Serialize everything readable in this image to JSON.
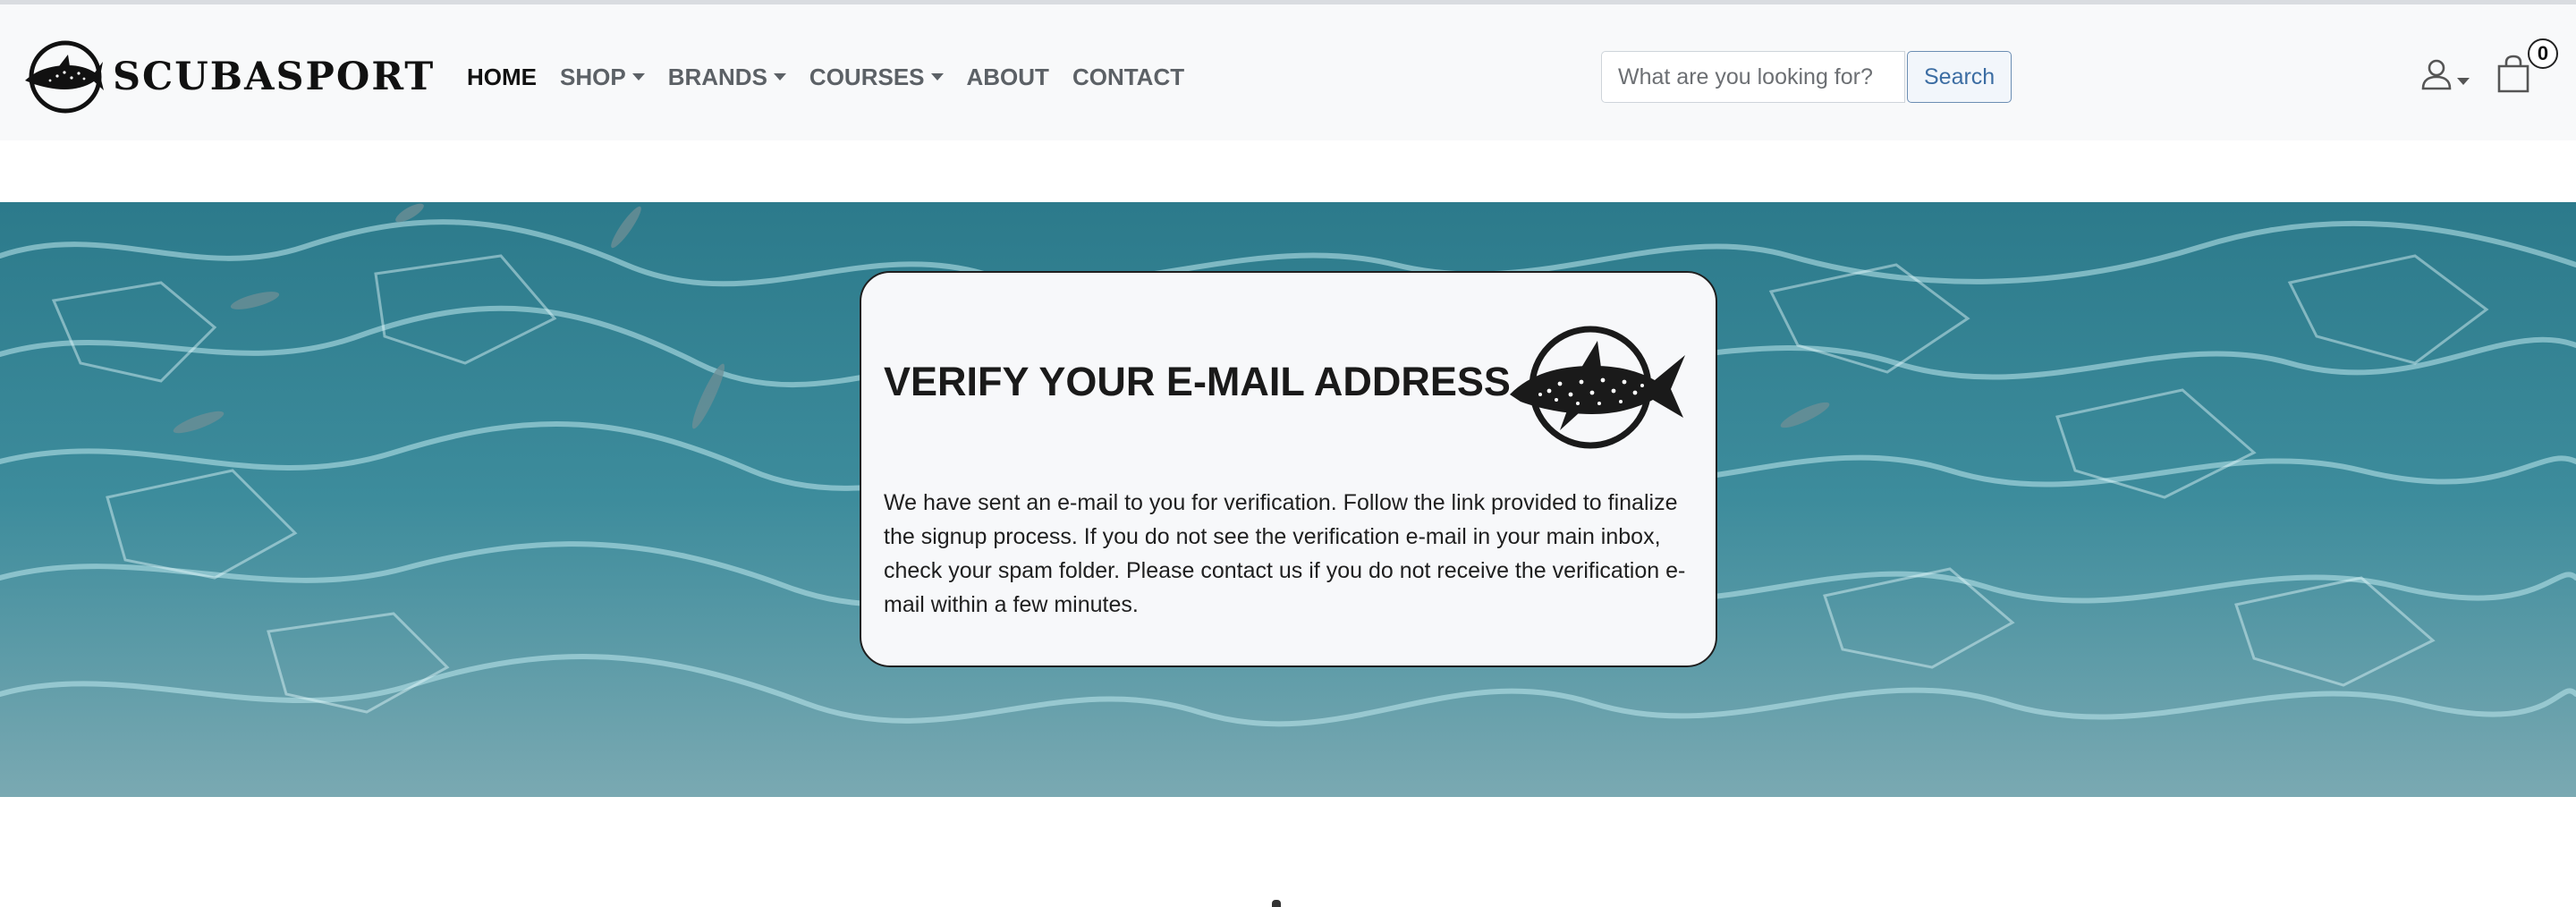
{
  "header": {
    "brand_name": "SCUBASPORT",
    "brand_logo_icon": "whale-shark-logo-icon",
    "nav": [
      {
        "label": "HOME",
        "active": true,
        "dropdown": false
      },
      {
        "label": "SHOP",
        "active": false,
        "dropdown": true
      },
      {
        "label": "BRANDS",
        "active": false,
        "dropdown": true
      },
      {
        "label": "COURSES",
        "active": false,
        "dropdown": true
      },
      {
        "label": "ABOUT",
        "active": false,
        "dropdown": false
      },
      {
        "label": "CONTACT",
        "active": false,
        "dropdown": false
      }
    ],
    "search": {
      "placeholder": "What are you looking for?",
      "value": "",
      "button_label": "Search"
    },
    "user_icon": "user-icon",
    "cart_icon": "shopping-bag-icon",
    "cart_count": "0"
  },
  "verify_card": {
    "title": "VERIFY YOUR E-MAIL ADDRESS",
    "message": "We have sent an e-mail to you for verification. Follow the link provided to finalize the signup process. If you do not see the verification e-mail in your main inbox, check your spam folder. Please contact us if you do not receive the verification e-mail within a few minutes.",
    "logo_icon": "whale-shark-logo-icon"
  },
  "colors": {
    "navbar_bg": "#f8f9fa",
    "nav_text": "#5c6166",
    "nav_active": "#111111",
    "search_button": "#3c6da3",
    "water": "#3f8fa0"
  }
}
